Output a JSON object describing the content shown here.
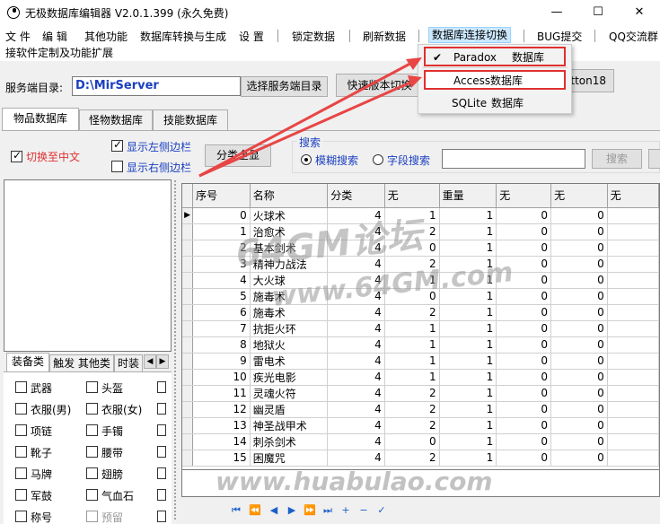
{
  "window": {
    "title": "无极数据库编辑器 V2.0.1.399 (永久免费)",
    "minimize": "—",
    "maximize": "☐",
    "close": "✕"
  },
  "menubar": {
    "row1": [
      "文 件",
      "编 辑",
      "其他功能",
      "数据库转换与生成",
      "设 置",
      "锁定数据",
      "刷新数据",
      "数据库连接切换",
      "BUG提交",
      "QQ交流群"
    ],
    "row2": "接软件定制及功能扩展"
  },
  "db_dropdown": {
    "items": [
      {
        "name": "Paradox",
        "suffix": "数据库",
        "checked": true
      },
      {
        "name": "Access",
        "suffix": "数据库",
        "checked": false
      },
      {
        "name": "SQLite",
        "suffix": "数据库",
        "checked": false
      }
    ]
  },
  "server": {
    "label": "服务端目录:",
    "path": "D:\\MirServer",
    "select_button": "选择服务端目录",
    "quick_switch_button": "快速版本切换",
    "hidden_button_partial": "utton18"
  },
  "tabs": [
    "物品数据库",
    "怪物数据库",
    "技能数据库"
  ],
  "options": {
    "chinese": "切换至中文",
    "show_left": "显示左侧边栏",
    "show_right": "显示右侧边栏",
    "all_categories": "分类全显"
  },
  "search": {
    "group_title": "搜索",
    "fuzzy": "模糊搜索",
    "field": "字段搜索",
    "button": "搜索"
  },
  "small_tabs": [
    "装备类",
    "触发 其他类",
    "时装"
  ],
  "categories": [
    {
      "label": "武器",
      "dim": false
    },
    {
      "label": "头盔",
      "dim": false
    },
    {
      "label": "衣服(男)",
      "dim": false
    },
    {
      "label": "衣服(女)",
      "dim": false
    },
    {
      "label": "项链",
      "dim": false
    },
    {
      "label": "手镯",
      "dim": false
    },
    {
      "label": "靴子",
      "dim": false
    },
    {
      "label": "腰带",
      "dim": false
    },
    {
      "label": "马牌",
      "dim": false
    },
    {
      "label": "翅膀",
      "dim": false
    },
    {
      "label": "军鼓",
      "dim": false
    },
    {
      "label": "气血石",
      "dim": false
    },
    {
      "label": "称号",
      "dim": false
    },
    {
      "label": "预留",
      "dim": true
    }
  ],
  "grid": {
    "columns": [
      "序号",
      "名称",
      "分类",
      "无",
      "重量",
      "无",
      "无",
      "无"
    ],
    "rows": [
      [
        "0",
        "火球术",
        "4",
        "1",
        "1",
        "0",
        "0"
      ],
      [
        "1",
        "治愈术",
        "4",
        "2",
        "1",
        "0",
        "0"
      ],
      [
        "2",
        "基本剑术",
        "4",
        "0",
        "1",
        "0",
        "0"
      ],
      [
        "3",
        "精神力战法",
        "4",
        "2",
        "1",
        "0",
        "0"
      ],
      [
        "4",
        "大火球",
        "4",
        "1",
        "1",
        "0",
        "0"
      ],
      [
        "5",
        "施毒术",
        "4",
        "0",
        "1",
        "0",
        "0"
      ],
      [
        "6",
        "施毒术",
        "4",
        "2",
        "1",
        "0",
        "0"
      ],
      [
        "7",
        "抗拒火环",
        "4",
        "1",
        "1",
        "0",
        "0"
      ],
      [
        "8",
        "地狱火",
        "4",
        "1",
        "1",
        "0",
        "0"
      ],
      [
        "9",
        "雷电术",
        "4",
        "1",
        "1",
        "0",
        "0"
      ],
      [
        "10",
        "疾光电影",
        "4",
        "1",
        "1",
        "0",
        "0"
      ],
      [
        "11",
        "灵魂火符",
        "4",
        "2",
        "1",
        "0",
        "0"
      ],
      [
        "12",
        "幽灵盾",
        "4",
        "2",
        "1",
        "0",
        "0"
      ],
      [
        "13",
        "神圣战甲术",
        "4",
        "2",
        "1",
        "0",
        "0"
      ],
      [
        "14",
        "刺杀剑术",
        "4",
        "0",
        "1",
        "0",
        "0"
      ],
      [
        "15",
        "困魔咒",
        "4",
        "2",
        "1",
        "0",
        "0"
      ]
    ]
  },
  "watermarks": {
    "forum": "64GM论坛",
    "site": "www.64GM.com",
    "bottom": "www.huabulao.com"
  },
  "colors": {
    "accent_red": "#e03030",
    "link_blue": "#1a3fbf",
    "arrow_red": "#e84545"
  }
}
